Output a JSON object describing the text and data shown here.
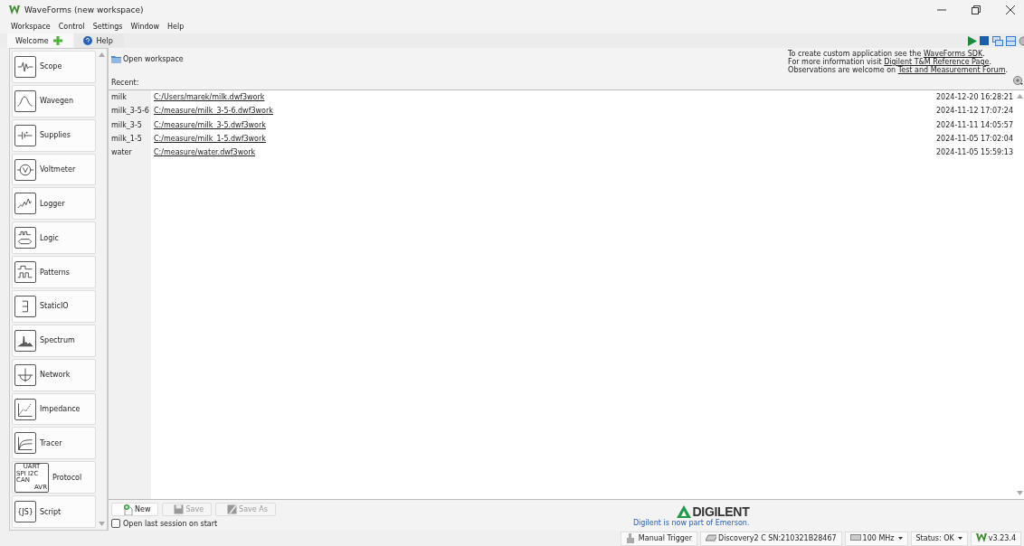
{
  "window": {
    "title": "WaveForms (new workspace)"
  },
  "menu": [
    "Workspace",
    "Control",
    "Settings",
    "Window",
    "Help"
  ],
  "tabs": [
    {
      "label": "Welcome",
      "selected": true,
      "kind": "welcome"
    },
    {
      "label": "Help",
      "selected": false,
      "kind": "help"
    }
  ],
  "instruments": [
    {
      "label": "Scope",
      "kind": "scope"
    },
    {
      "label": "Wavegen",
      "kind": "wavegen"
    },
    {
      "label": "Supplies",
      "kind": "supplies"
    },
    {
      "label": "Voltmeter",
      "kind": "voltmeter"
    },
    {
      "label": "Logger",
      "kind": "logger"
    },
    {
      "label": "Logic",
      "kind": "logic"
    },
    {
      "label": "Patterns",
      "kind": "patterns"
    },
    {
      "label": "StaticIO",
      "kind": "staticio"
    },
    {
      "label": "Spectrum",
      "kind": "spectrum"
    },
    {
      "label": "Network",
      "kind": "network"
    },
    {
      "label": "Impedance",
      "kind": "impedance"
    },
    {
      "label": "Tracer",
      "kind": "tracer"
    },
    {
      "label": "Protocol",
      "kind": "protocol",
      "icon_text": [
        "UART",
        "SPI I2C",
        "CAN",
        "AVR"
      ]
    },
    {
      "label": "Script",
      "kind": "script",
      "icon_text": [
        "{JS}"
      ]
    }
  ],
  "open_workspace": "Open workspace",
  "info": [
    [
      "To create custom application see the ",
      "WaveForms SDK",
      "."
    ],
    [
      "For more information visit ",
      "Digilent T&M Reference Page",
      "."
    ],
    [
      "Observations are welcome on ",
      "Test and Measurement Forum",
      "."
    ]
  ],
  "recent_label": "Recent:",
  "recent": [
    {
      "name": "milk",
      "path": "C:/Users/marek/milk.dwf3work",
      "date": "2024-12-20 16:28:21"
    },
    {
      "name": "milk_3-5-6",
      "path": "C:/measure/milk_3-5-6.dwf3work",
      "date": "2024-11-12 17:07:24"
    },
    {
      "name": "milk_3-5",
      "path": "C:/measure/milk_3-5.dwf3work",
      "date": "2024-11-11 14:05:57"
    },
    {
      "name": "milk_1-5",
      "path": "C:/measure/milk_1-5.dwf3work",
      "date": "2024-11-05 17:02:04"
    },
    {
      "name": "water",
      "path": "C:/measure/water.dwf3work",
      "date": "2024-11-05 15:59:13"
    }
  ],
  "buttons": [
    {
      "label": "New",
      "disabled": false,
      "kind": "new"
    },
    {
      "label": "Save",
      "disabled": true,
      "kind": "save"
    },
    {
      "label": "Save As",
      "disabled": true,
      "kind": "saveas"
    }
  ],
  "open_last_session": {
    "label": "Open last session on start",
    "checked": false
  },
  "logo": {
    "name": "DIGILENT",
    "tagline": "Digilent is now part of Emerson."
  },
  "status_bar": [
    {
      "label": "Manual Trigger",
      "kind": "trigger"
    },
    {
      "label": "Discovery2 C SN:210321B28467",
      "kind": "device"
    },
    {
      "label": "100 MHz",
      "kind": "clock"
    },
    {
      "label": "Status: OK",
      "kind": "status"
    },
    {
      "label": "v3.23.4",
      "kind": "version"
    }
  ]
}
